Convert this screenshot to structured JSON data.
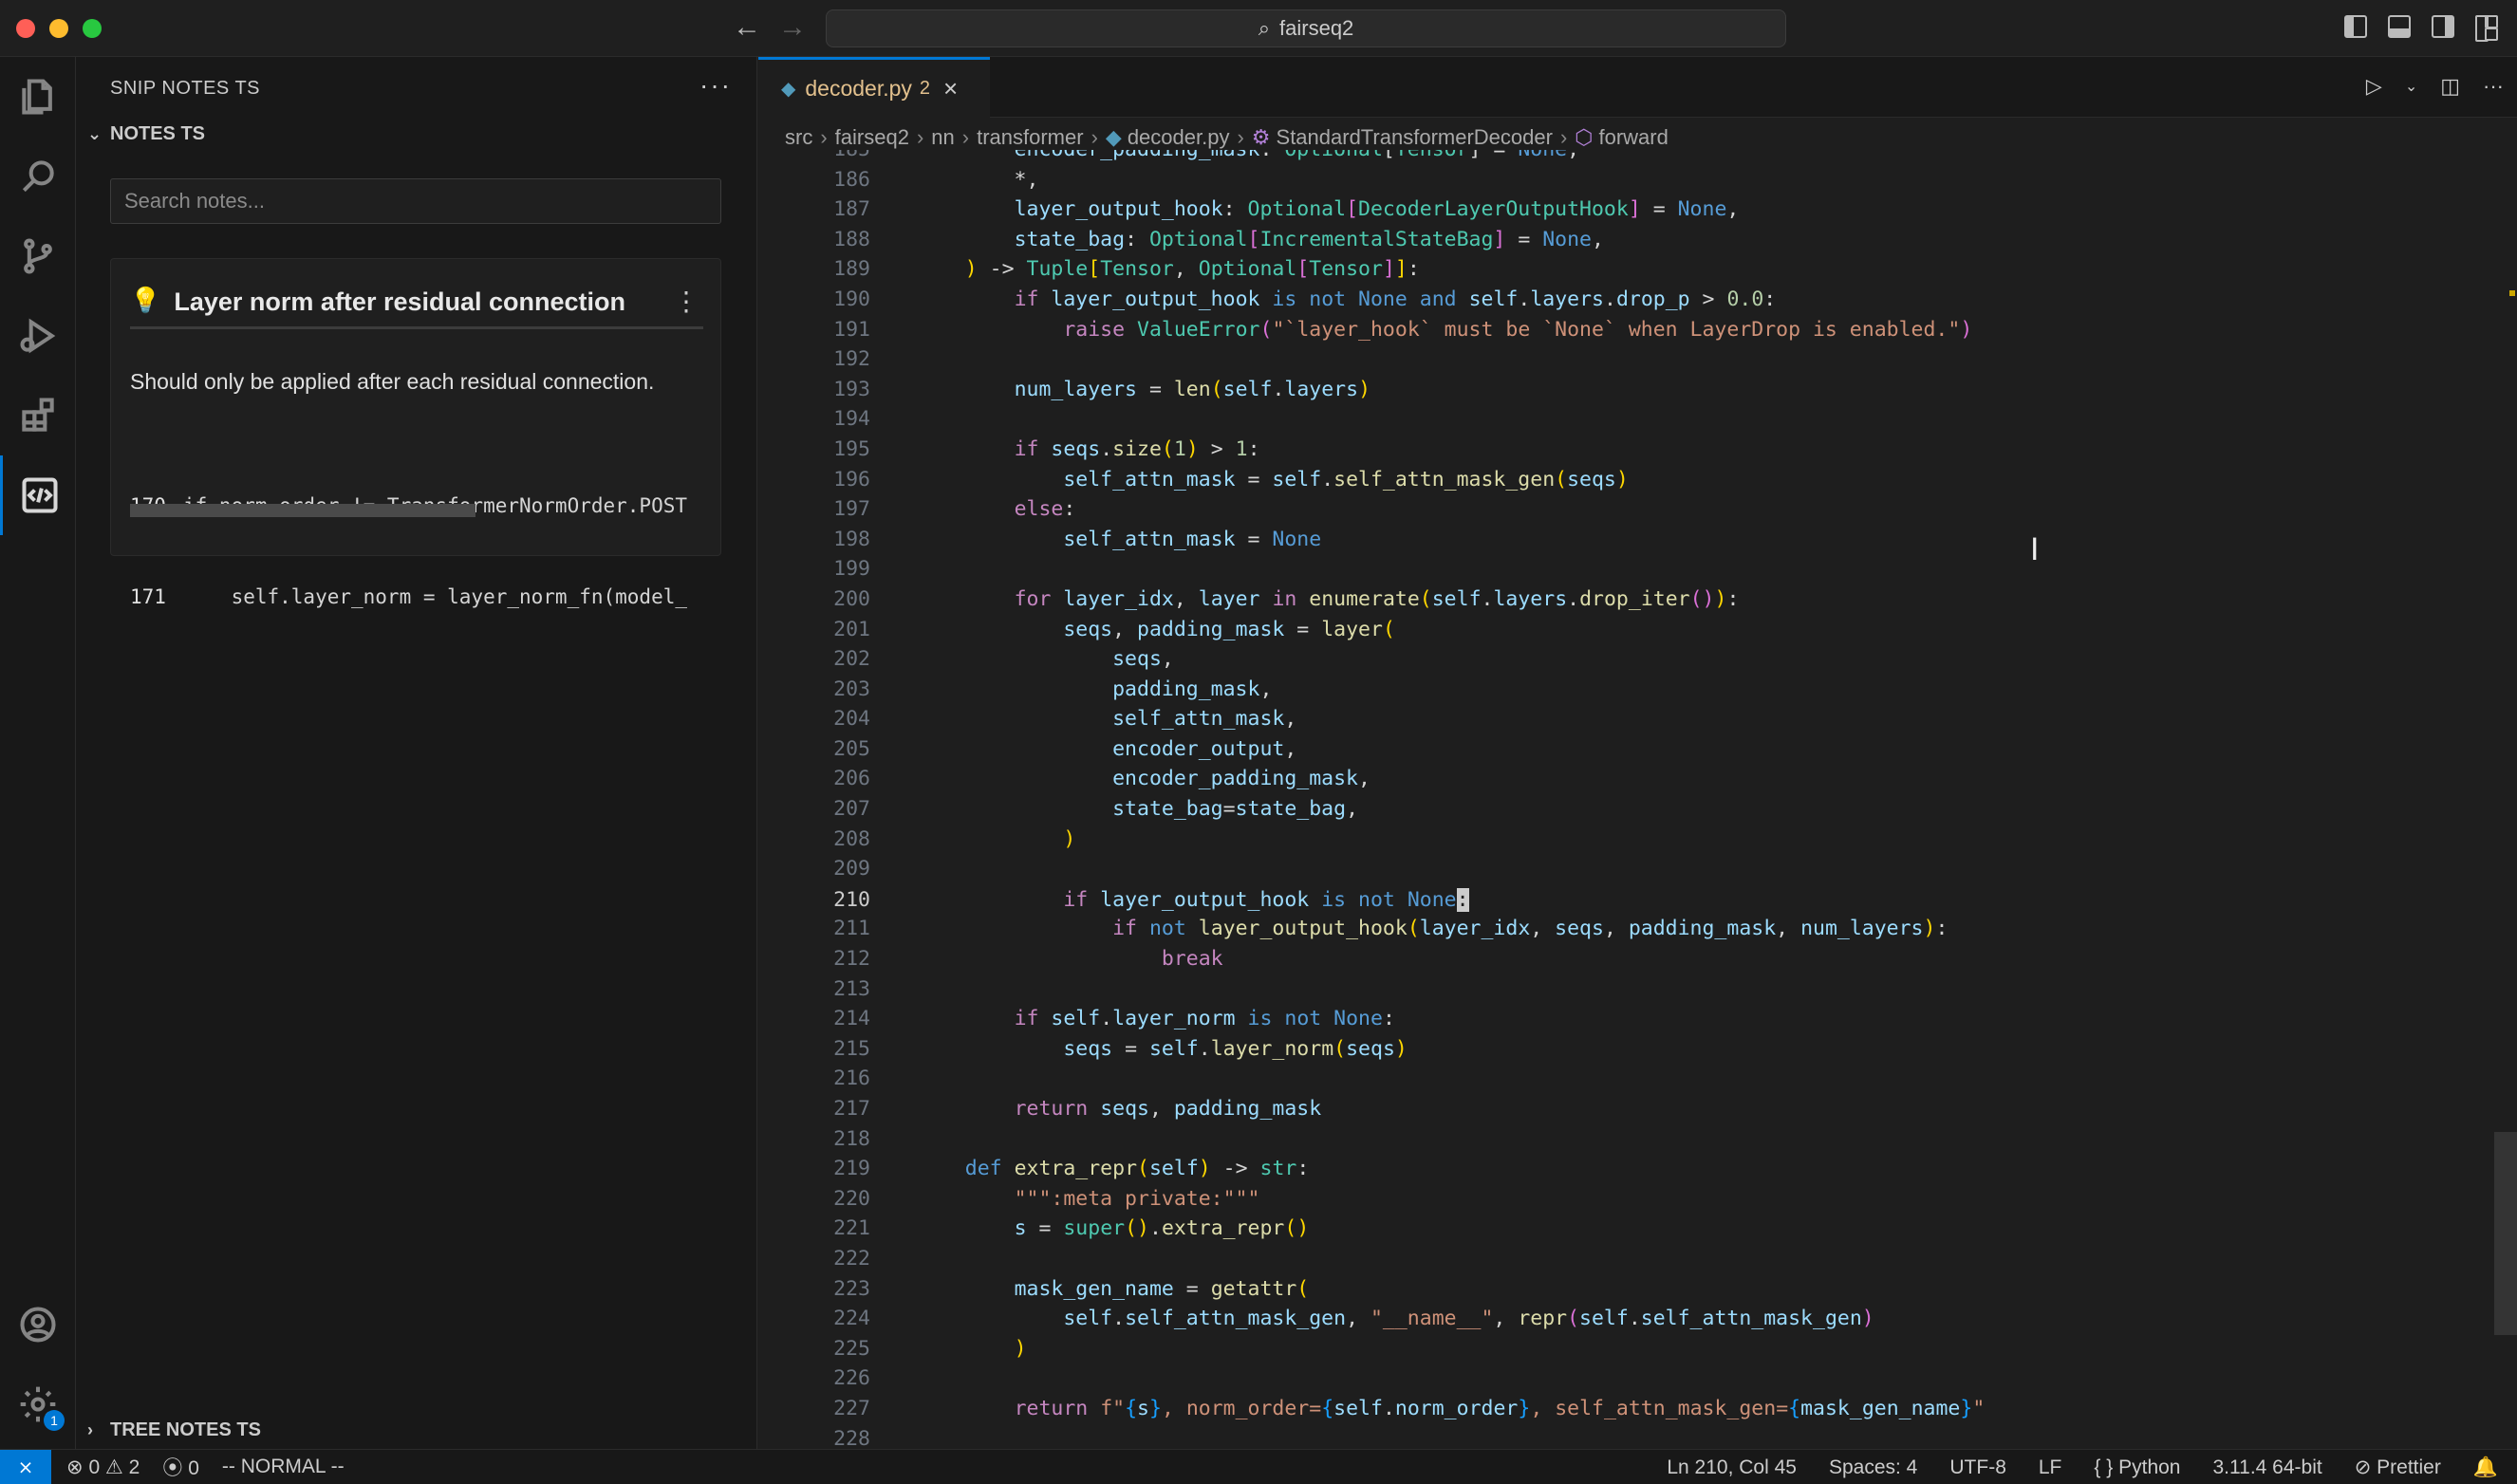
{
  "window": {
    "search_text": "fairseq2"
  },
  "sidebar": {
    "header": "SNIP NOTES TS",
    "section_title": "NOTES TS",
    "search_placeholder": "Search notes...",
    "note": {
      "title": "Layer norm after residual connection",
      "description": "Should only be applied after each residual connection.",
      "code_lines": [
        {
          "num": "170",
          "text": "if norm_order != TransformerNormOrder.POST"
        },
        {
          "num": "171",
          "text": "    self.layer_norm = layer_norm_fn(model_"
        }
      ]
    },
    "tree_section_title": "TREE NOTES TS"
  },
  "activity_bar": {
    "items": [
      "files-icon",
      "search-icon",
      "source-control-icon",
      "run-debug-icon",
      "extensions-icon",
      "snip-notes-icon"
    ],
    "bottom": [
      "account-icon",
      "settings-icon"
    ],
    "settings_badge": "1"
  },
  "editor": {
    "tab": {
      "filename": "decoder.py",
      "problems": "2"
    },
    "breadcrumb": [
      "src",
      "fairseq2",
      "nn",
      "transformer",
      "decoder.py",
      "StandardTransformerDecoder",
      "forward"
    ],
    "current_line": "210"
  },
  "statusbar": {
    "errors": "0",
    "warnings": "2",
    "ports": "0",
    "mode": "-- NORMAL --",
    "position": "Ln 210, Col 45",
    "spaces": "Spaces: 4",
    "encoding": "UTF-8",
    "eol": "LF",
    "language": "Python",
    "interpreter": "3.11.4 64-bit",
    "formatter": "Prettier"
  },
  "colors": {
    "accent": "#0078d4",
    "modified_tab": "#e2c08d"
  }
}
